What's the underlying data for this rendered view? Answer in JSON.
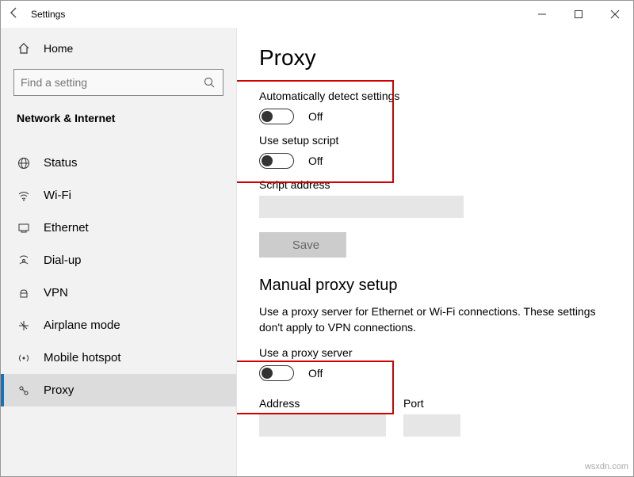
{
  "window": {
    "title": "Settings"
  },
  "sidebar": {
    "home": "Home",
    "search_placeholder": "Find a setting",
    "category": "Network & Internet",
    "items": [
      {
        "label": "Status"
      },
      {
        "label": "Wi-Fi"
      },
      {
        "label": "Ethernet"
      },
      {
        "label": "Dial-up"
      },
      {
        "label": "VPN"
      },
      {
        "label": "Airplane mode"
      },
      {
        "label": "Mobile hotspot"
      },
      {
        "label": "Proxy"
      }
    ]
  },
  "main": {
    "heading": "Proxy",
    "auto_detect_label": "Automatically detect settings",
    "auto_detect_state": "Off",
    "setup_script_label": "Use setup script",
    "setup_script_state": "Off",
    "script_address_label": "Script address",
    "save_label": "Save",
    "manual_heading": "Manual proxy setup",
    "manual_desc": "Use a proxy server for Ethernet or Wi-Fi connections. These settings don't apply to VPN connections.",
    "use_proxy_label": "Use a proxy server",
    "use_proxy_state": "Off",
    "address_label": "Address",
    "port_label": "Port"
  },
  "watermark": "wsxdn.com"
}
